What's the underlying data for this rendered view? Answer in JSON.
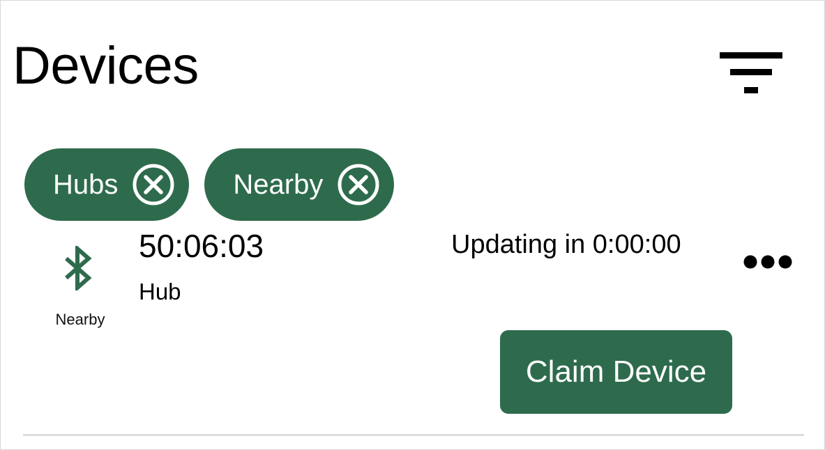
{
  "header": {
    "title": "Devices",
    "filter_icon": "filter-icon"
  },
  "filters": {
    "chips": [
      {
        "label": "Hubs",
        "remove_icon": "close-circle-icon"
      },
      {
        "label": "Nearby",
        "remove_icon": "close-circle-icon"
      }
    ]
  },
  "device": {
    "id": "50:06:03",
    "type": "Hub",
    "connection_icon": "bluetooth-icon",
    "connection_label": "Nearby",
    "status": "Updating in 0:00:00",
    "more_icon": "more-horizontal-icon",
    "claim_label": "Claim Device"
  },
  "colors": {
    "accent": "#2e6b4c",
    "text": "#000000",
    "divider": "#dcdcdc"
  }
}
